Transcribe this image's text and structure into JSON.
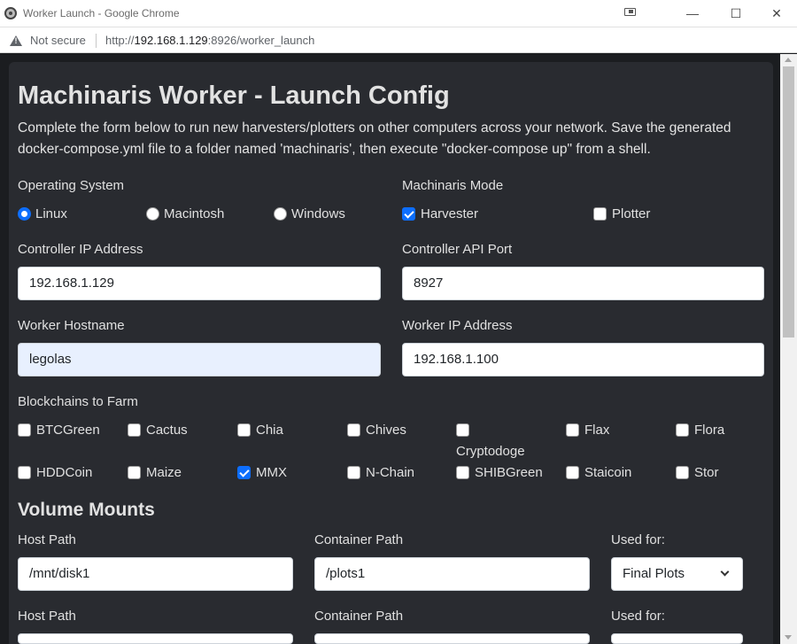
{
  "window": {
    "title": "Worker Launch - Google Chrome",
    "minimize": "—",
    "maximize": "☐",
    "close": "✕"
  },
  "address": {
    "security": "Not secure",
    "url_prefix": "http://",
    "url_host": "192.168.1.129",
    "url_rest": ":8926/worker_launch"
  },
  "page": {
    "title": "Machinaris Worker - Launch Config",
    "description": "Complete the form below to run new harvesters/plotters on other computers across your network. Save the generated docker-compose.yml file to a folder named 'machinaris', then execute \"docker-compose up\" from a shell.",
    "os": {
      "label": "Operating System",
      "options": [
        "Linux",
        "Macintosh",
        "Windows"
      ],
      "selected": "Linux"
    },
    "mode": {
      "label": "Machinaris Mode",
      "options": [
        {
          "label": "Harvester",
          "checked": true
        },
        {
          "label": "Plotter",
          "checked": false
        }
      ]
    },
    "controller_ip": {
      "label": "Controller IP Address",
      "value": "192.168.1.129"
    },
    "controller_port": {
      "label": "Controller API Port",
      "value": "8927"
    },
    "worker_hostname": {
      "label": "Worker Hostname",
      "value": "legolas"
    },
    "worker_ip": {
      "label": "Worker IP Address",
      "value": "192.168.1.100"
    },
    "blockchains": {
      "label": "Blockchains to Farm",
      "items": [
        {
          "label": "BTCGreen",
          "checked": false
        },
        {
          "label": "Cactus",
          "checked": false
        },
        {
          "label": "Chia",
          "checked": false
        },
        {
          "label": "Chives",
          "checked": false
        },
        {
          "label": "Cryptodoge",
          "checked": false
        },
        {
          "label": "Flax",
          "checked": false
        },
        {
          "label": "Flora",
          "checked": false
        },
        {
          "label": "HDDCoin",
          "checked": false
        },
        {
          "label": "Maize",
          "checked": false
        },
        {
          "label": "MMX",
          "checked": true
        },
        {
          "label": "N-Chain",
          "checked": false
        },
        {
          "label": "SHIBGreen",
          "checked": false
        },
        {
          "label": "Staicoin",
          "checked": false
        },
        {
          "label": "Stor",
          "checked": false
        }
      ]
    },
    "volumes": {
      "heading": "Volume Mounts",
      "rows": [
        {
          "host_label": "Host Path",
          "host_value": "/mnt/disk1",
          "container_label": "Container Path",
          "container_value": "/plots1",
          "used_label": "Used for:",
          "used_value": "Final Plots"
        },
        {
          "host_label": "Host Path",
          "host_value": "",
          "container_label": "Container Path",
          "container_value": "",
          "used_label": "Used for:",
          "used_value": ""
        }
      ]
    }
  },
  "colors": {
    "accent": "#0d6efd",
    "card_bg": "#292b30",
    "page_bg": "#1b1d20"
  }
}
